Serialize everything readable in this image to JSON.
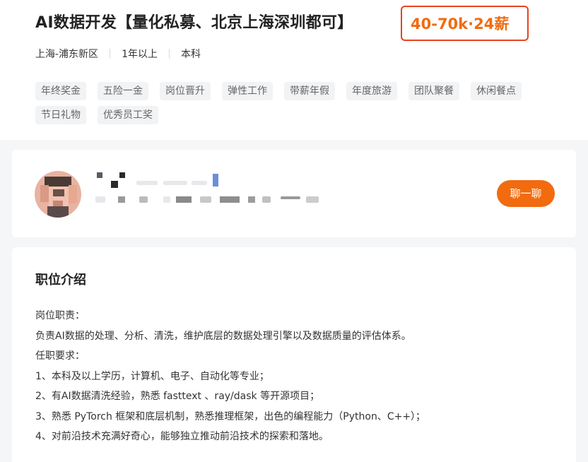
{
  "job": {
    "title": "AI数据开发【量化私募、北京上海深圳都可】",
    "salary": "40-70k·24薪",
    "location": "上海-浦东新区",
    "experience": "1年以上",
    "education": "本科",
    "tags": [
      "年终奖金",
      "五险一金",
      "岗位晋升",
      "弹性工作",
      "带薪年假",
      "年度旅游",
      "团队聚餐",
      "休闲餐点",
      "节日礼物",
      "优秀员工奖"
    ]
  },
  "recruiter": {
    "chat_button": "聊一聊"
  },
  "description": {
    "title": "职位介绍",
    "lines": [
      "岗位职责：",
      "负责AI数据的处理、分析、清洗，维护底层的数据处理引擎以及数据质量的评估体系。",
      "任职要求：",
      "1、本科及以上学历，计算机、电子、自动化等专业；",
      "2、有AI数据清洗经验，熟悉 fasttext 、ray/dask 等开源项目；",
      "3、熟悉 PyTorch 框架和底层机制，熟悉推理框架，出色的编程能力（Python、C++）；",
      "4、对前沿技术充满好奇心，能够独立推动前沿技术的探索和落地。"
    ]
  },
  "colors": {
    "accent": "#f26b0f",
    "highlight_border": "#e8431f"
  }
}
